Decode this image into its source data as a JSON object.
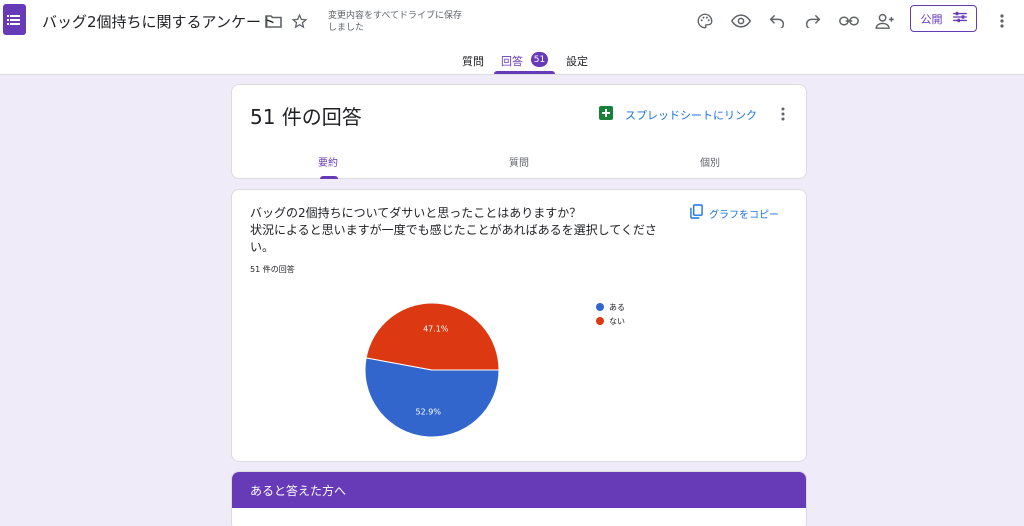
{
  "header": {
    "title": "バッグ2個持ちに関するアンケート",
    "save_status": "変更内容をすべてドライブに保存しました",
    "publish_label": "公開"
  },
  "tabs": [
    {
      "label": "質問"
    },
    {
      "label": "回答",
      "badge": "51"
    },
    {
      "label": "設定"
    }
  ],
  "summary": {
    "title": "51 件の回答",
    "sheets_link": "スプレッドシートにリンク",
    "subtabs": [
      "要約",
      "質問",
      "個別"
    ]
  },
  "question": {
    "text": "バッグの2個持ちについてダサいと思ったことはありますか？\n状況によると思いますが一度でも感じたことがあればあるを選択してください。",
    "copy_label": "グラフをコピー",
    "response_count": "51 件の回答"
  },
  "chart_data": {
    "type": "pie",
    "categories": [
      "ある",
      "ない"
    ],
    "values": [
      52.9,
      47.1
    ],
    "labels": [
      "52.9%",
      "47.1%"
    ],
    "colors": [
      "#3366cc",
      "#dc3912"
    ],
    "legend_position": "right"
  },
  "section": {
    "title": "あると答えた方へ"
  }
}
